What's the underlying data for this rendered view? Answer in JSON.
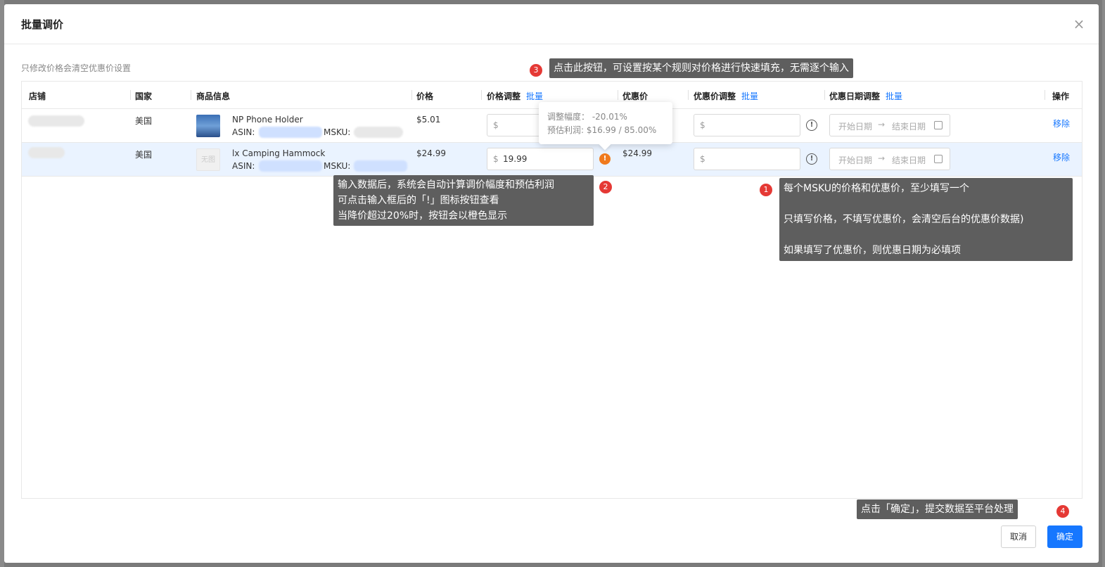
{
  "modal": {
    "title": "批量调价",
    "close_glyph": "×",
    "hint": "只修改价格会清空优惠价设置"
  },
  "table": {
    "headers": {
      "store": "店铺",
      "country": "国家",
      "product": "商品信息",
      "price": "价格",
      "price_adjust": "价格调整",
      "sale_price": "优惠价",
      "sale_adjust": "优惠价调整",
      "date_adjust": "优惠日期调整",
      "action": "操作"
    },
    "batch_label": "批量",
    "rows": [
      {
        "country": "美国",
        "product_name": "NP Phone Holder",
        "asin_label": "ASIN:",
        "msku_label": "MSKU:",
        "price": "$5.01",
        "price_input_prefix": "$",
        "price_input_value": "",
        "sale_price": "",
        "sale_input_prefix": "$",
        "date_start": "开始日期",
        "date_arrow": "→",
        "date_end": "结束日期",
        "action": "移除"
      },
      {
        "country": "美国",
        "thumb_placeholder": "无图",
        "product_name": "lx Camping Hammock",
        "asin_label": "ASIN:",
        "msku_label": "MSKU:",
        "price": "$24.99",
        "price_input_prefix": "$",
        "price_input_value": "19.99",
        "sale_price": "$24.99",
        "sale_input_prefix": "$",
        "date_start": "开始日期",
        "date_arrow": "→",
        "date_end": "结束日期",
        "action": "移除"
      }
    ]
  },
  "popover": {
    "line1": "调整幅度： -20.01%",
    "line2": "预估利润: $16.99 / 85.00%"
  },
  "callouts": {
    "c1": {
      "badge": "1",
      "line1": "每个MSKU的价格和优惠价，至少填写一个",
      "line2": "只填写价格，不填写优惠价，会清空后台的优惠价数据)",
      "line3": "如果填写了优惠价，则优惠日期为必填项"
    },
    "c2": {
      "badge": "2",
      "line1": "输入数据后，系统会自动计算调价幅度和预估利润",
      "line2": "可点击输入框后的「!」图标按钮查看",
      "line3": "当降价超过20%时，按钮会以橙色显示"
    },
    "c3": {
      "badge": "3",
      "text": "点击此按钮，可设置按某个规则对价格进行快速填充，无需逐个输入"
    },
    "c4": {
      "badge": "4",
      "text": "点击「确定」，提交数据至平台处理"
    }
  },
  "footer": {
    "cancel": "取消",
    "ok": "确定"
  },
  "icons": {
    "info": "!",
    "warn": "!"
  },
  "colors": {
    "accent": "#1677ff",
    "warn": "#f07a1d",
    "badge": "#e53935",
    "callout_bg": "#5e5e5e",
    "row_highlight": "#eaf3ff"
  }
}
